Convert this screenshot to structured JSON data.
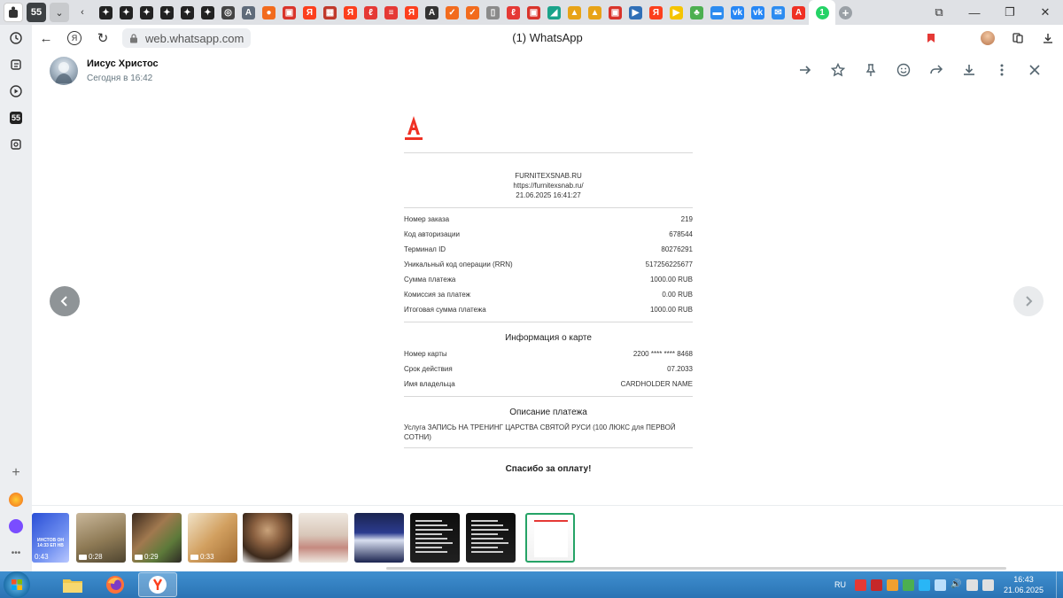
{
  "browser": {
    "tab_count": "55",
    "url": "web.whatsapp.com",
    "page_title": "(1) WhatsApp",
    "tab_icons": [
      {
        "icon": "sparkle-icon",
        "color": "#222222",
        "glyph": "✦"
      },
      {
        "icon": "sparkle-icon",
        "color": "#222222",
        "glyph": "✦"
      },
      {
        "icon": "sparkle-icon",
        "color": "#222222",
        "glyph": "✦"
      },
      {
        "icon": "sparkle-icon",
        "color": "#222222",
        "glyph": "✦"
      },
      {
        "icon": "sparkle-icon",
        "color": "#222222",
        "glyph": "✦"
      },
      {
        "icon": "sparkle-icon",
        "color": "#222222",
        "glyph": "✦"
      },
      {
        "icon": "openai-icon",
        "color": "#444444",
        "glyph": "◎"
      },
      {
        "icon": "a-icon",
        "color": "#5f6b7a",
        "glyph": "A"
      },
      {
        "icon": "orange-circle-icon",
        "color": "#f26b1d",
        "glyph": "●"
      },
      {
        "icon": "red-doc-icon",
        "color": "#d9342b",
        "glyph": "▣"
      },
      {
        "icon": "yandex-icon",
        "color": "#fc3f1d",
        "glyph": "Я"
      },
      {
        "icon": "grid-icon",
        "color": "#c0392b",
        "glyph": "▦"
      },
      {
        "icon": "yandex-icon",
        "color": "#fc3f1d",
        "glyph": "Я"
      },
      {
        "icon": "feather-icon",
        "color": "#e53935",
        "glyph": "ℓ"
      },
      {
        "icon": "stripe-icon",
        "color": "#e53935",
        "glyph": "≡"
      },
      {
        "icon": "yandex-icon",
        "color": "#fc3f1d",
        "glyph": "Я"
      },
      {
        "icon": "a-letter-icon",
        "color": "#333333",
        "glyph": "A"
      },
      {
        "icon": "check-icon",
        "color": "#f26b1d",
        "glyph": "✓"
      },
      {
        "icon": "check-icon",
        "color": "#f26b1d",
        "glyph": "✓"
      },
      {
        "icon": "doc-icon",
        "color": "#8a8a8a",
        "glyph": "▯"
      },
      {
        "icon": "feather-icon",
        "color": "#e53935",
        "glyph": "ℓ"
      },
      {
        "icon": "red-doc-icon",
        "color": "#d9342b",
        "glyph": "▣"
      },
      {
        "icon": "teal-icon",
        "color": "#1aa38a",
        "glyph": "◢"
      },
      {
        "icon": "image-icon",
        "color": "#e8a317",
        "glyph": "▲"
      },
      {
        "icon": "image-icon",
        "color": "#e8a317",
        "glyph": "▲"
      },
      {
        "icon": "red-doc-icon",
        "color": "#d9342b",
        "glyph": "▣"
      },
      {
        "icon": "play-icon",
        "color": "#2f6fb7",
        "glyph": "▶"
      },
      {
        "icon": "yandex-icon",
        "color": "#fc3f1d",
        "glyph": "Я"
      },
      {
        "icon": "play-circle-icon",
        "color": "#f5c400",
        "glyph": "▶"
      },
      {
        "icon": "plant-icon",
        "color": "#4caf50",
        "glyph": "♣"
      },
      {
        "icon": "message-icon",
        "color": "#2d8cf0",
        "glyph": "▬"
      },
      {
        "icon": "vk-icon",
        "color": "#2787f5",
        "glyph": "vk"
      },
      {
        "icon": "vk-icon",
        "color": "#2787f5",
        "glyph": "vk"
      },
      {
        "icon": "mail-icon",
        "color": "#2d8cf0",
        "glyph": "✉"
      },
      {
        "icon": "alfa-icon",
        "color": "#ef3124",
        "glyph": "A"
      }
    ]
  },
  "sidebar": {
    "counter": "55"
  },
  "viewer": {
    "contact_name": "Иисус Христос",
    "timestamp": "Сегодня в 16:42"
  },
  "receipt": {
    "merchant": "FURNITEXSNAB.RU",
    "merchant_url": "https://furnitexsnab.ru/",
    "datetime": "21.06.2025 16:41:27",
    "rows": [
      {
        "label": "Номер заказа",
        "value": "219"
      },
      {
        "label": "Код авторизации",
        "value": "678544"
      },
      {
        "label": "Терминал ID",
        "value": "80276291"
      },
      {
        "label": "Уникальный код операции (RRN)",
        "value": "517256225677"
      },
      {
        "label": "Сумма платежа",
        "value": "1000.00 RUB"
      },
      {
        "label": "Комиссия за платеж",
        "value": "0.00 RUB"
      },
      {
        "label": "Итоговая сумма платежа",
        "value": "1000.00 RUB"
      }
    ],
    "card_section_title": "Информация о карте",
    "card_rows": [
      {
        "label": "Номер карты",
        "value": "2200 **** **** 8468"
      },
      {
        "label": "Срок действия",
        "value": "07.2033"
      },
      {
        "label": "Имя владельца",
        "value": "CARDHOLDER NAME"
      }
    ],
    "description_title": "Описание платежа",
    "description": "Услуга ЗАПИСЬ НА ТРЕНИНГ ЦАРСТВА СВЯТОЙ РУСИ (100 ЛЮКС для ПЕРВОЙ СОТНИ)",
    "thanks": "Спасибо за оплату!"
  },
  "thumbnails": [
    {
      "kind": "video",
      "duration": "0:43",
      "caption": "ИНСТОВ ОН 14:33 ЕП НВ"
    },
    {
      "kind": "video",
      "duration": "0:28"
    },
    {
      "kind": "video",
      "duration": "0:29"
    },
    {
      "kind": "video",
      "duration": "0:33"
    },
    {
      "kind": "image"
    },
    {
      "kind": "image"
    },
    {
      "kind": "image"
    },
    {
      "kind": "image"
    },
    {
      "kind": "image"
    },
    {
      "kind": "image",
      "selected": true
    }
  ],
  "taskbar": {
    "language": "RU",
    "time": "16:43",
    "date": "21.06.2025"
  }
}
